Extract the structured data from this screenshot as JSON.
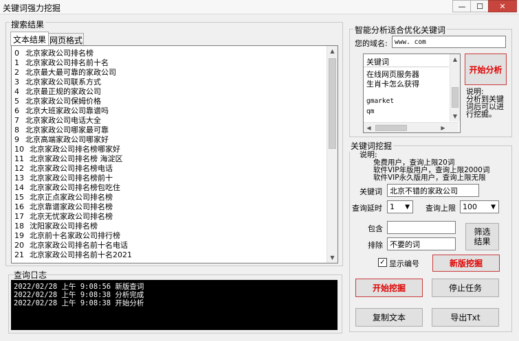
{
  "window": {
    "title": "关键词强力挖掘",
    "minimize": "—",
    "maximize": "☐",
    "close": "✕"
  },
  "search_results": {
    "group_title": "搜索结果",
    "tabs": [
      "文本结果",
      "网页格式"
    ],
    "rows": [
      {
        "n": "0",
        "text": "北京家政公司排名榜"
      },
      {
        "n": "1",
        "text": "北京家政公司排名前十名"
      },
      {
        "n": "2",
        "text": "北京最大最可靠的家政公司"
      },
      {
        "n": "3",
        "text": "北京家政公司联系方式"
      },
      {
        "n": "4",
        "text": "北京最正规的家政公司"
      },
      {
        "n": "5",
        "text": "北京家政公司保姆价格"
      },
      {
        "n": "6",
        "text": "北京大班家政公司靠谱吗"
      },
      {
        "n": "7",
        "text": "北京家政公司电话大全"
      },
      {
        "n": "8",
        "text": "北京家政公司哪家最可靠"
      },
      {
        "n": "9",
        "text": "北京高端家政公司哪家好"
      },
      {
        "n": "10",
        "text": "北京家政公司排名榜哪家好"
      },
      {
        "n": "11",
        "text": "北京家政公司排名榜 海淀区"
      },
      {
        "n": "12",
        "text": "北京家政公司排名榜电话"
      },
      {
        "n": "13",
        "text": "北京家政公司排名榜前十"
      },
      {
        "n": "14",
        "text": "北京家政公司排名榜包吃住"
      },
      {
        "n": "15",
        "text": "北京正点家政公司排名榜"
      },
      {
        "n": "16",
        "text": "北京靠谱家政公司排名榜"
      },
      {
        "n": "17",
        "text": "北京无忧家政公司排名榜"
      },
      {
        "n": "18",
        "text": "沈阳家政公司排名榜"
      },
      {
        "n": "19",
        "text": "北京前十名家政公司排行榜"
      },
      {
        "n": "20",
        "text": "北京家政公司排名前十名电话"
      },
      {
        "n": "21",
        "text": "北京家政公司排名前十名2021"
      }
    ]
  },
  "query_log": {
    "group_title": "查询日志",
    "lines": [
      "2022/02/28 上午 9:08:56 新版查词",
      "2022/02/28 上午 9:08:38 分析完成",
      "2022/02/28 上午 9:08:38 开始分析"
    ]
  },
  "analysis": {
    "group_title": "智能分析适合优化关键词",
    "domain_label": "您的域名:",
    "domain_value": "www.          com",
    "list_header": "关键词",
    "keywords": [
      "在线网页服务器",
      "生肖卡怎么获得",
      "",
      "gmarket",
      "qm"
    ],
    "start_button": "开始分析",
    "note": "说明:\n分析到关键\n词后可以进\n行挖掘。"
  },
  "mining": {
    "group_title": "关键词挖掘",
    "note_title": "说明:",
    "note_lines": [
      "免费用户，查询上限20词",
      "软件VIP年版用户，查询上限2000词",
      "软件VIP永久版用户，查询上限无限"
    ],
    "keyword_label": "关键词",
    "keyword_value": "北京不错的家政公司",
    "delay_label": "查询延时",
    "delay_value": "1",
    "limit_label": "查询上限",
    "limit_value": "100",
    "include_label": "包含",
    "include_value": "",
    "exclude_label": "排除",
    "exclude_value": "不要的词",
    "filter_button": "筛选\n结果",
    "show_number_label": "显示编号",
    "show_number_checked": "✓",
    "new_mining_button": "新版挖掘",
    "start_mining_button": "开始挖掘",
    "stop_button": "停止任务",
    "copy_button": "复制文本",
    "export_button": "导出Txt"
  }
}
